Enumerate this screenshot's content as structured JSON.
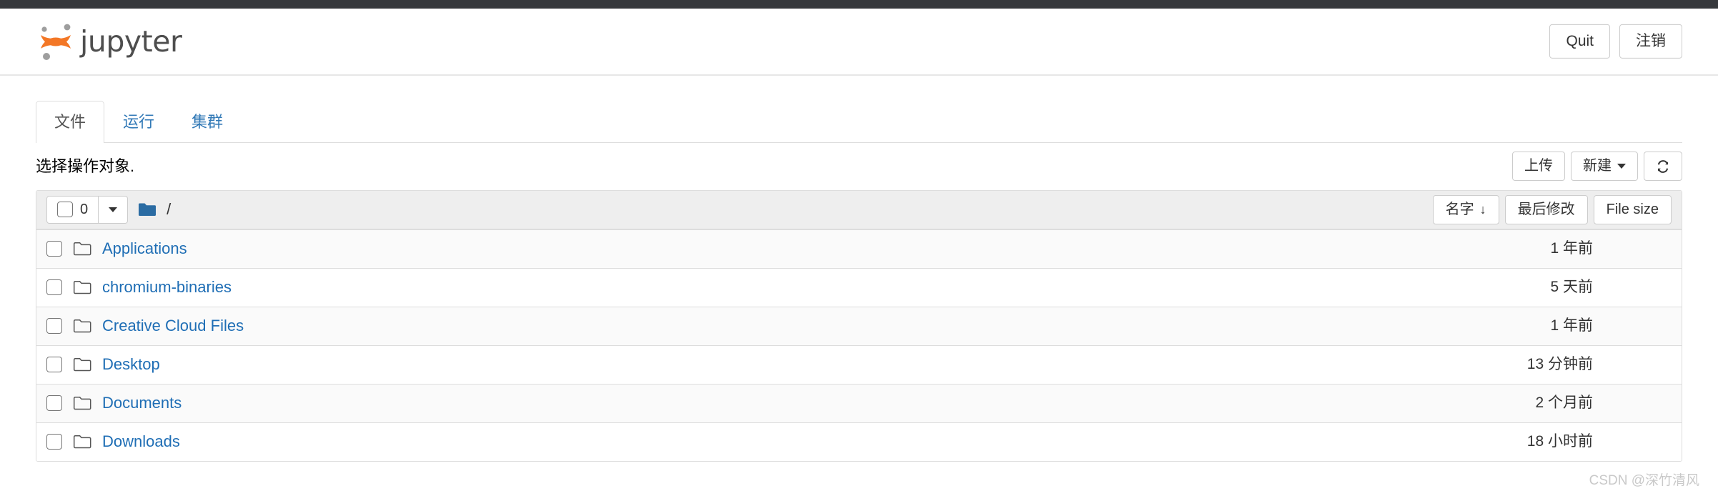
{
  "header": {
    "brand_text": "jupyter",
    "logo_icon": "jupyter-logo",
    "quit_label": "Quit",
    "logout_label": "注销"
  },
  "tabs": [
    {
      "label": "文件",
      "active": true
    },
    {
      "label": "运行",
      "active": false
    },
    {
      "label": "集群",
      "active": false
    }
  ],
  "actions": {
    "select_note": "选择操作对象.",
    "upload_label": "上传",
    "new_label": "新建",
    "new_caret_icon": "caret-down-icon",
    "refresh_icon": "refresh-icon"
  },
  "list_header": {
    "select_all_checkbox_icon": "checkbox-unchecked-icon",
    "selected_count": "0",
    "dropdown_caret_icon": "caret-down-icon",
    "breadcrumb_folder_icon": "folder-filled-icon",
    "breadcrumb_path": "/",
    "sort_name_label": "名字",
    "sort_name_arrow": "↓",
    "sort_modified_label": "最后修改",
    "sort_filesize_label": "File size"
  },
  "rows": [
    {
      "checkbox_icon": "checkbox-unchecked-icon",
      "icon": "folder-icon",
      "name": "Applications",
      "modified": "1 年前"
    },
    {
      "checkbox_icon": "checkbox-unchecked-icon",
      "icon": "folder-icon",
      "name": "chromium-binaries",
      "modified": "5 天前"
    },
    {
      "checkbox_icon": "checkbox-unchecked-icon",
      "icon": "folder-icon",
      "name": "Creative Cloud Files",
      "modified": "1 年前"
    },
    {
      "checkbox_icon": "checkbox-unchecked-icon",
      "icon": "folder-icon",
      "name": "Desktop",
      "modified": "13 分钟前"
    },
    {
      "checkbox_icon": "checkbox-unchecked-icon",
      "icon": "folder-icon",
      "name": "Documents",
      "modified": "2 个月前"
    },
    {
      "checkbox_icon": "checkbox-unchecked-icon",
      "icon": "folder-icon",
      "name": "Downloads",
      "modified": "18 小时前"
    }
  ],
  "watermark": "CSDN @深竹清风",
  "colors": {
    "brand_orange": "#f37726",
    "link_blue": "#1f6eb5",
    "tab_blue": "#337ab7",
    "topbar_dark": "#36383c",
    "header_grey": "#eeeeee",
    "row_alt": "#fafafa"
  }
}
